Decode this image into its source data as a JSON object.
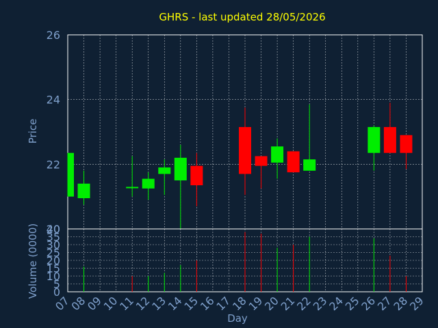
{
  "chart_data": [
    {
      "type": "candlestick",
      "title": "GHRS - last updated 28/05/2026",
      "ylabel": "Price",
      "ylim": [
        20,
        26
      ],
      "yticks": [
        20,
        22,
        24,
        26
      ],
      "xlabel": "",
      "grid": true,
      "colors": {
        "up": "#00ee00",
        "down": "#ff0000",
        "background": "#0f2033",
        "axes": "#ffffff",
        "grid": "#ffffff",
        "text": "#7fa0cc",
        "title": "#ffff00"
      },
      "candles": [
        {
          "day": "07",
          "open": 21.0,
          "high": 22.35,
          "low": 21.0,
          "close": 22.35
        },
        {
          "day": "08",
          "open": 20.95,
          "high": 21.8,
          "low": 20.75,
          "close": 21.4
        },
        {
          "day": "11",
          "open": 21.3,
          "high": 22.25,
          "low": 21.0,
          "close": 21.3
        },
        {
          "day": "12",
          "open": 21.25,
          "high": 21.75,
          "low": 20.9,
          "close": 21.55
        },
        {
          "day": "13",
          "open": 21.7,
          "high": 22.15,
          "low": 21.05,
          "close": 21.9
        },
        {
          "day": "14",
          "open": 21.5,
          "high": 22.6,
          "low": 20.0,
          "close": 22.2
        },
        {
          "day": "15",
          "open": 21.95,
          "high": 22.35,
          "low": 20.7,
          "close": 21.35
        },
        {
          "day": "18",
          "open": 23.15,
          "high": 23.75,
          "low": 21.05,
          "close": 21.7
        },
        {
          "day": "19",
          "open": 22.25,
          "high": 22.25,
          "low": 21.25,
          "close": 21.95
        },
        {
          "day": "20",
          "open": 22.05,
          "high": 22.8,
          "low": 21.55,
          "close": 22.55
        },
        {
          "day": "21",
          "open": 22.4,
          "high": 22.4,
          "low": 21.75,
          "close": 21.75
        },
        {
          "day": "22",
          "open": 21.8,
          "high": 23.85,
          "low": 21.8,
          "close": 22.15
        },
        {
          "day": "26",
          "open": 22.35,
          "high": 23.2,
          "low": 21.8,
          "close": 23.15
        },
        {
          "day": "27",
          "open": 23.15,
          "high": 23.9,
          "low": 22.35,
          "close": 22.35
        },
        {
          "day": "28",
          "open": 22.9,
          "high": 22.9,
          "low": 21.85,
          "close": 22.35
        }
      ]
    },
    {
      "type": "bar",
      "title": "",
      "ylabel": "Volume (0000)",
      "xlabel": "Day",
      "ylim": [
        0,
        40
      ],
      "yticks": [
        0,
        5,
        10,
        15,
        20,
        25,
        30,
        35,
        40
      ],
      "categories": [
        "07",
        "08",
        "09",
        "10",
        "11",
        "12",
        "13",
        "14",
        "15",
        "16",
        "17",
        "18",
        "19",
        "20",
        "21",
        "22",
        "23",
        "24",
        "25",
        "26",
        "27",
        "28",
        "29"
      ],
      "bars": [
        {
          "day": "08",
          "value": 16,
          "direction": "up"
        },
        {
          "day": "11",
          "value": 10,
          "direction": "down"
        },
        {
          "day": "12",
          "value": 10,
          "direction": "up"
        },
        {
          "day": "13",
          "value": 12,
          "direction": "up"
        },
        {
          "day": "14",
          "value": 17,
          "direction": "up"
        },
        {
          "day": "15",
          "value": 20,
          "direction": "down"
        },
        {
          "day": "18",
          "value": 38,
          "direction": "down"
        },
        {
          "day": "19",
          "value": 37,
          "direction": "down"
        },
        {
          "day": "20",
          "value": 28,
          "direction": "up"
        },
        {
          "day": "21",
          "value": 30,
          "direction": "down"
        },
        {
          "day": "22",
          "value": 35,
          "direction": "up"
        },
        {
          "day": "26",
          "value": 34,
          "direction": "up"
        },
        {
          "day": "27",
          "value": 23,
          "direction": "down"
        },
        {
          "day": "28",
          "value": 10,
          "direction": "down"
        }
      ]
    }
  ]
}
